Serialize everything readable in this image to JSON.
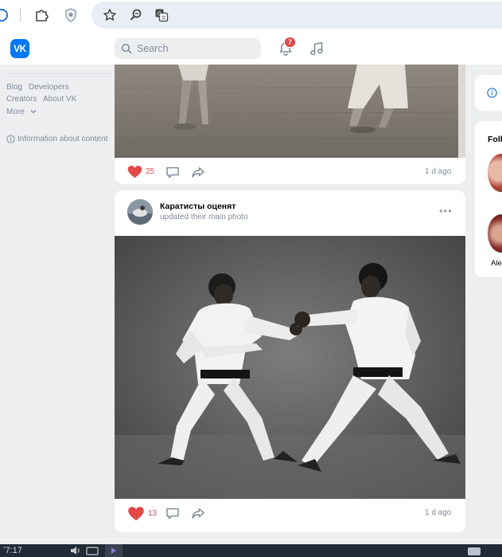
{
  "browser": {
    "icons": [
      "profile-icon",
      "extension-puzzle-icon",
      "shield-extension-icon",
      "bookmark-star-icon",
      "zoom-icon",
      "translate-icon"
    ]
  },
  "header": {
    "logo": "VK",
    "search_placeholder": "Search",
    "notifications_count": "7"
  },
  "sidebar": {
    "links_row1": [
      "Blog",
      "Developers"
    ],
    "links_row2": [
      "Creators",
      "About VK"
    ],
    "more_label": "More",
    "info_label": "Information about content"
  },
  "feed": {
    "post1": {
      "likes": "25",
      "time": "1 d ago"
    },
    "post2": {
      "author": "Каратисты оценят",
      "subtitle": "updated their main photo",
      "more": "•••",
      "likes": "13",
      "time": "1 d ago"
    }
  },
  "right": {
    "card_title": "Foll",
    "friend_name": "Ale"
  },
  "taskbar": {
    "text": "ʼ7:17"
  },
  "colors": {
    "brand": "#0077ff",
    "like": "#e64646",
    "secondary_text": "#818c99",
    "page_bg": "#edeef0"
  }
}
